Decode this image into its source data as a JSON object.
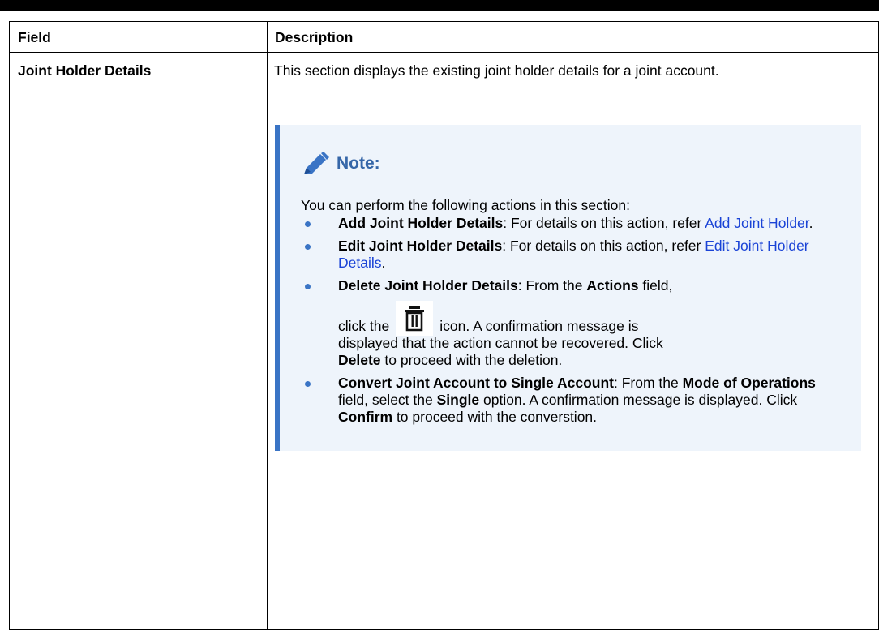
{
  "header": {
    "field": "Field",
    "description": "Description"
  },
  "row": {
    "field": "Joint Holder Details",
    "intro": "This section displays the existing joint holder details for a joint account."
  },
  "note": {
    "title": "Note:",
    "lead": "You can perform the following actions in this section:",
    "items": [
      {
        "bold": "Add Joint Holder Details",
        "text": ": For details on this action, refer ",
        "link": "Add Joint Holder",
        "end": "."
      },
      {
        "bold": "Edit Joint Holder Details",
        "text": ": For details on this action, refer ",
        "link": "Edit Joint Holder Details",
        "end": "."
      },
      {
        "bold": "Delete Joint Holder Details",
        "text1": ": From the ",
        "bold2": "Actions",
        "text2": " field,",
        "pre_icon": "click the",
        "post_icon": "icon. A confirmation message is",
        "rest": "displayed that the action cannot be recovered. Click",
        "bold3": "Delete",
        "text3": " to proceed with the deletion.",
        "icon": "trash-icon"
      },
      {
        "bold": "Convert Joint Account to Single Account",
        "text1": ": From the ",
        "bold2": "Mode of Operations",
        "text2": " field, select the ",
        "bold3": "Single",
        "text3": " option. A confirmation message is displayed. Click ",
        "bold4": "Confirm",
        "text4": " to proceed with the converstion."
      }
    ]
  },
  "colors": {
    "accent": "#3a74c5",
    "link": "#1a43d6",
    "note_bg": "#eef4fb",
    "note_title": "#3566a8"
  }
}
